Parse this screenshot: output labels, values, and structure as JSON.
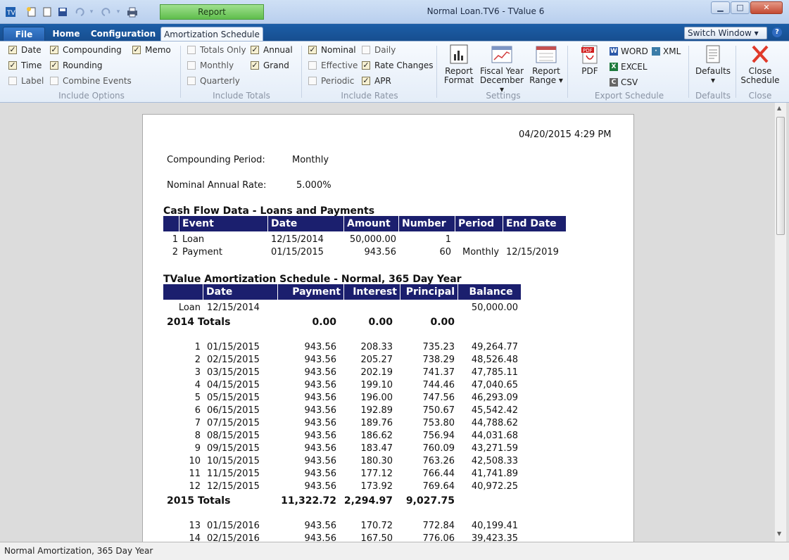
{
  "window": {
    "title": "Normal Loan.TV6 - TValue 6",
    "report_tab": "Report",
    "minimize": "▁",
    "maximize": "□",
    "close": "✕"
  },
  "tabs": {
    "file": "File",
    "home": "Home",
    "configuration": "Configuration",
    "amortization": "Amortization Schedule",
    "switch_window": "Switch Window ▾",
    "help": "?"
  },
  "ribbon": {
    "include_options": {
      "label": "Include Options",
      "items": [
        {
          "label": "Date",
          "checked": true
        },
        {
          "label": "Time",
          "checked": true
        },
        {
          "label": "Label",
          "checked": false
        },
        {
          "label": "Compounding",
          "checked": true
        },
        {
          "label": "Rounding",
          "checked": true
        },
        {
          "label": "Combine Events",
          "checked": false
        },
        {
          "label": "Memo",
          "checked": true
        }
      ]
    },
    "include_totals": {
      "label": "Include Totals",
      "items": [
        {
          "label": "Totals Only",
          "checked": false
        },
        {
          "label": "Monthly",
          "checked": false
        },
        {
          "label": "Quarterly",
          "checked": false
        },
        {
          "label": "Annual",
          "checked": true
        },
        {
          "label": "Grand",
          "checked": true
        }
      ]
    },
    "include_rates": {
      "label": "Include Rates",
      "items": [
        {
          "label": "Nominal",
          "checked": true
        },
        {
          "label": "Effective",
          "checked": false
        },
        {
          "label": "Periodic",
          "checked": false
        },
        {
          "label": "Daily",
          "checked": false
        },
        {
          "label": "Rate Changes",
          "checked": true
        },
        {
          "label": "APR",
          "checked": true
        }
      ]
    },
    "settings": {
      "label": "Settings",
      "report_format": [
        "Report",
        "Format"
      ],
      "fiscal_year": [
        "Fiscal Year",
        "December ▾"
      ],
      "report_range": [
        "Report",
        "Range ▾"
      ]
    },
    "export": {
      "label": "Export Schedule",
      "pdf": "PDF",
      "word": "WORD",
      "excel": "EXCEL",
      "csv": "CSV",
      "xml": "XML"
    },
    "defaults": {
      "label": "Defaults",
      "button": "Defaults",
      "arrow": "▾"
    },
    "close": {
      "label": "Close",
      "button": [
        "Close",
        "Schedule"
      ]
    }
  },
  "report": {
    "datetime": "04/20/2015   4:29 PM",
    "compounding_label": "Compounding Period:",
    "compounding_value": "Monthly",
    "rate_label": "Nominal Annual Rate:",
    "rate_value": "5.000%",
    "cashflow_title": "Cash Flow Data - Loans and Payments",
    "cashflow_headers": [
      "Event",
      "Date",
      "Amount",
      "Number",
      "Period",
      "End Date"
    ],
    "cashflow_rows": [
      [
        "1",
        "Loan",
        "12/15/2014",
        "50,000.00",
        "1",
        "",
        ""
      ],
      [
        "2",
        "Payment",
        "01/15/2015",
        "943.56",
        "60",
        "Monthly",
        "12/15/2019"
      ]
    ],
    "amort_title": "TValue Amortization Schedule - Normal, 365 Day Year",
    "amort_headers": [
      "Date",
      "Payment",
      "Interest",
      "Principal",
      "Balance"
    ],
    "loan_row": {
      "label": "Loan",
      "date": "12/15/2014",
      "balance": "50,000.00"
    },
    "totals_2014": {
      "label": "2014 Totals",
      "payment": "0.00",
      "interest": "0.00",
      "principal": "0.00"
    },
    "rows_2015": [
      [
        "1",
        "01/15/2015",
        "943.56",
        "208.33",
        "735.23",
        "49,264.77"
      ],
      [
        "2",
        "02/15/2015",
        "943.56",
        "205.27",
        "738.29",
        "48,526.48"
      ],
      [
        "3",
        "03/15/2015",
        "943.56",
        "202.19",
        "741.37",
        "47,785.11"
      ],
      [
        "4",
        "04/15/2015",
        "943.56",
        "199.10",
        "744.46",
        "47,040.65"
      ],
      [
        "5",
        "05/15/2015",
        "943.56",
        "196.00",
        "747.56",
        "46,293.09"
      ],
      [
        "6",
        "06/15/2015",
        "943.56",
        "192.89",
        "750.67",
        "45,542.42"
      ],
      [
        "7",
        "07/15/2015",
        "943.56",
        "189.76",
        "753.80",
        "44,788.62"
      ],
      [
        "8",
        "08/15/2015",
        "943.56",
        "186.62",
        "756.94",
        "44,031.68"
      ],
      [
        "9",
        "09/15/2015",
        "943.56",
        "183.47",
        "760.09",
        "43,271.59"
      ],
      [
        "10",
        "10/15/2015",
        "943.56",
        "180.30",
        "763.26",
        "42,508.33"
      ],
      [
        "11",
        "11/15/2015",
        "943.56",
        "177.12",
        "766.44",
        "41,741.89"
      ],
      [
        "12",
        "12/15/2015",
        "943.56",
        "173.92",
        "769.64",
        "40,972.25"
      ]
    ],
    "totals_2015": {
      "label": "2015 Totals",
      "payment": "11,322.72",
      "interest": "2,294.97",
      "principal": "9,027.75"
    },
    "rows_2016": [
      [
        "13",
        "01/15/2016",
        "943.56",
        "170.72",
        "772.84",
        "40,199.41"
      ],
      [
        "14",
        "02/15/2016",
        "943.56",
        "167.50",
        "776.06",
        "39,423.35"
      ]
    ]
  },
  "status": "Normal Amortization, 365 Day Year"
}
